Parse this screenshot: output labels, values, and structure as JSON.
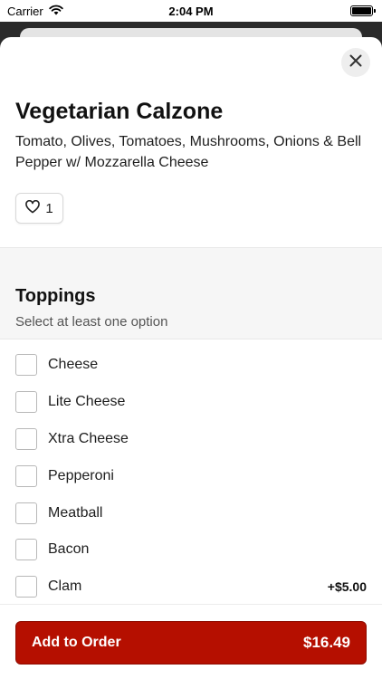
{
  "status_bar": {
    "carrier": "Carrier",
    "time": "2:04 PM",
    "icons": [
      "wifi-icon",
      "battery-icon"
    ]
  },
  "item": {
    "title": "Vegetarian Calzone",
    "description": "Tomato, Olives, Tomatoes, Mushrooms, Onions & Bell Pepper w/ Mozzarella Cheese",
    "likes": "1",
    "like_icon": "heart-icon",
    "close_icon": "close-icon"
  },
  "toppings": {
    "title": "Toppings",
    "subtitle": "Select at least one option",
    "options": [
      {
        "label": "Cheese",
        "price": ""
      },
      {
        "label": "Lite Cheese",
        "price": ""
      },
      {
        "label": "Xtra Cheese",
        "price": ""
      },
      {
        "label": "Pepperoni",
        "price": ""
      },
      {
        "label": "Meatball",
        "price": ""
      },
      {
        "label": "Bacon",
        "price": ""
      },
      {
        "label": "Clam",
        "price": "+$5.00"
      }
    ]
  },
  "footer": {
    "add_label": "Add to Order",
    "total": "$16.49"
  },
  "colors": {
    "accent": "#b50f00",
    "background": "#ffffff",
    "section_bg": "#f6f6f6"
  }
}
